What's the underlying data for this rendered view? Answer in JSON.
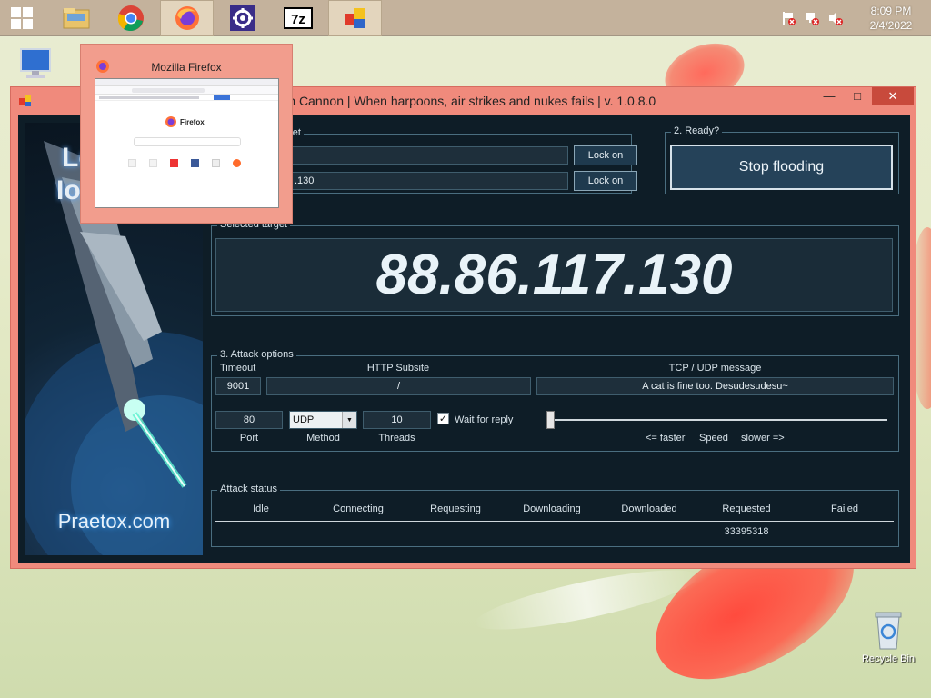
{
  "taskbar": {
    "time": "8:09 PM",
    "date": "2/4/2022"
  },
  "desktop": {
    "recycle_bin_label": "Recycle Bin"
  },
  "preview": {
    "title": "Mozilla Firefox",
    "firefox_label": "Firefox"
  },
  "loic": {
    "title": "t Ion Cannon | When harpoons, air strikes and nukes fails | v. 1.0.8.0",
    "side_text_1": "Lo",
    "side_text_2": "Ion",
    "side_footer": "Praetox.com",
    "select_target_title": "rget",
    "url_lock_label": "Lock on",
    "ip_value": ".130",
    "ip_lock_label": "Lock on",
    "ready_title": "2. Ready?",
    "stop_label": "Stop flooding",
    "selected_target_title": "Selected target",
    "selected_target_value": "88.86.117.130",
    "attack_options_title": "3. Attack options",
    "timeout_label": "Timeout",
    "timeout_value": "9001",
    "http_subsite_label": "HTTP Subsite",
    "http_subsite_value": "/",
    "tcp_udp_label": "TCP / UDP message",
    "tcp_udp_value": "A cat is fine too. Desudesudesu~",
    "port_value": "80",
    "port_label": "Port",
    "method_value": "UDP",
    "method_label": "Method",
    "threads_value": "10",
    "threads_label": "Threads",
    "wait_for_reply_label": "Wait for reply",
    "wait_for_reply_checked": true,
    "speed_faster": "<= faster",
    "speed_label": "Speed",
    "speed_slower": "slower =>",
    "speed_position": 0.0,
    "attack_status_title": "Attack status",
    "status_headers": [
      "Idle",
      "Connecting",
      "Requesting",
      "Downloading",
      "Downloaded",
      "Requested",
      "Failed"
    ],
    "status_values": [
      "",
      "",
      "",
      "",
      "",
      "33395318",
      ""
    ]
  }
}
